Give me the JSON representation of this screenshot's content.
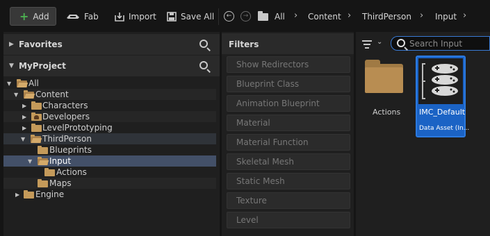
{
  "toolbar": {
    "add_label": "Add",
    "fab_label": "Fab",
    "import_label": "Import",
    "save_all_label": "Save All"
  },
  "breadcrumb": [
    "All",
    "Content",
    "ThirdPerson",
    "Input"
  ],
  "favorites": {
    "title": "Favorites"
  },
  "project": {
    "title": "MyProject"
  },
  "tree": [
    {
      "label": "All"
    },
    {
      "label": "Content"
    },
    {
      "label": "Characters"
    },
    {
      "label": "Developers"
    },
    {
      "label": "LevelPrototyping"
    },
    {
      "label": "ThirdPerson"
    },
    {
      "label": "Blueprints"
    },
    {
      "label": "Input"
    },
    {
      "label": "Actions"
    },
    {
      "label": "Maps"
    },
    {
      "label": "Engine"
    }
  ],
  "filters": {
    "title": "Filters",
    "items": [
      "Show Redirectors",
      "Blueprint Class",
      "Animation Blueprint",
      "Material",
      "Material Function",
      "Skeletal Mesh",
      "Static Mesh",
      "Texture",
      "Level"
    ]
  },
  "search": {
    "placeholder": "Search Input"
  },
  "assets": [
    {
      "name": "Actions"
    },
    {
      "name": "IMC_Default",
      "type": "Data Asset (In..."
    }
  ],
  "colors": {
    "accent": "#1b63c5",
    "selection": "#435068",
    "folder": "#c49a5a",
    "add_plus": "#4caf50"
  }
}
